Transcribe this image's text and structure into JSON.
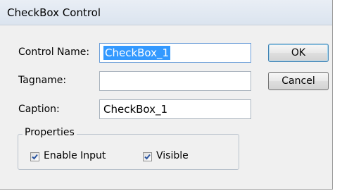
{
  "window": {
    "title": "CheckBox Control"
  },
  "form": {
    "control_name_label": "Control Name:",
    "control_name_value": "CheckBox_1",
    "tagname_label": "Tagname:",
    "tagname_value": "",
    "caption_label": "Caption:",
    "caption_value": "CheckBox_1"
  },
  "buttons": {
    "ok": "OK",
    "cancel": "Cancel"
  },
  "properties": {
    "legend": "Properties",
    "enable_input_label": "Enable Input",
    "enable_input_checked": true,
    "visible_label": "Visible",
    "visible_checked": true
  },
  "icons": {
    "checkmark": "check-icon"
  },
  "colors": {
    "selection": "#3399ff",
    "check": "#2b55a0"
  }
}
